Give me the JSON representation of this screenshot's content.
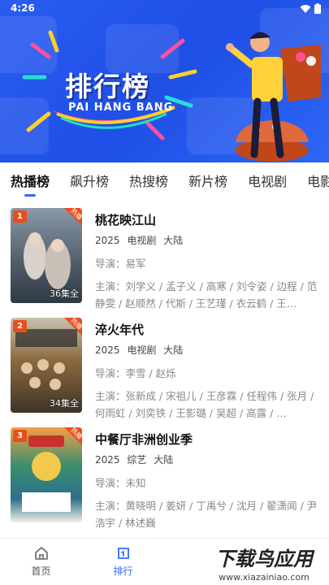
{
  "status_bar": {
    "time": "4:26"
  },
  "banner": {
    "title": "排行榜",
    "subtitle": "PAI HANG BANG"
  },
  "tabs": [
    {
      "label": "热播榜",
      "active": true
    },
    {
      "label": "飙升榜"
    },
    {
      "label": "热搜榜"
    },
    {
      "label": "新片榜"
    },
    {
      "label": "电视剧"
    },
    {
      "label": "电影"
    }
  ],
  "list": [
    {
      "rank": "1",
      "hot_badge": "热播",
      "episodes": "36集全",
      "title": "桃花映江山",
      "year": "2025",
      "type": "电视剧",
      "region": "大陆",
      "director": "导演：易军",
      "cast": "主演：刘学义 / 孟子义 / 高寒 / 刘令姿 / 边程 / 范静雯 / 赵顺然 / 代斯 / 王艺瑾 / 衣云鹤 / 王…",
      "poster_color": "#5b6a78"
    },
    {
      "rank": "2",
      "hot_badge": "热播",
      "episodes": "34集全",
      "title": "淬火年代",
      "year": "2025",
      "type": "电视剧",
      "region": "大陆",
      "director": "导演：李雪 / 赵烁",
      "cast": "主演：张新成 / 宋祖儿 / 王彦霖 / 任程伟 / 张月 / 何雨虹 / 刘奕铁 / 王影璐 / 吴超 / 高露 / …",
      "poster_color": "#8a6a3e"
    },
    {
      "rank": "3",
      "hot_badge": "热播",
      "episodes": "",
      "title": "中餐厅非洲创业季",
      "year": "2025",
      "type": "综艺",
      "region": "大陆",
      "director": "导演：未知",
      "cast": "主演：黄晓明 / 姜妍 / 丁禹兮 / 沈月 / 翟潇闻 / 尹浩宇 / 林述巍",
      "poster_color": "#3a8f6e"
    }
  ],
  "bottom_nav": [
    {
      "label": "首页",
      "icon": "home-icon"
    },
    {
      "label": "排行",
      "icon": "ranking-icon",
      "active": true
    }
  ],
  "watermark": "下载鸟应用 www.xiazainiao.com",
  "colors": {
    "accent": "#2f6bff",
    "banner": "#2a5cf2",
    "rank_badge": "#e94e1b"
  }
}
